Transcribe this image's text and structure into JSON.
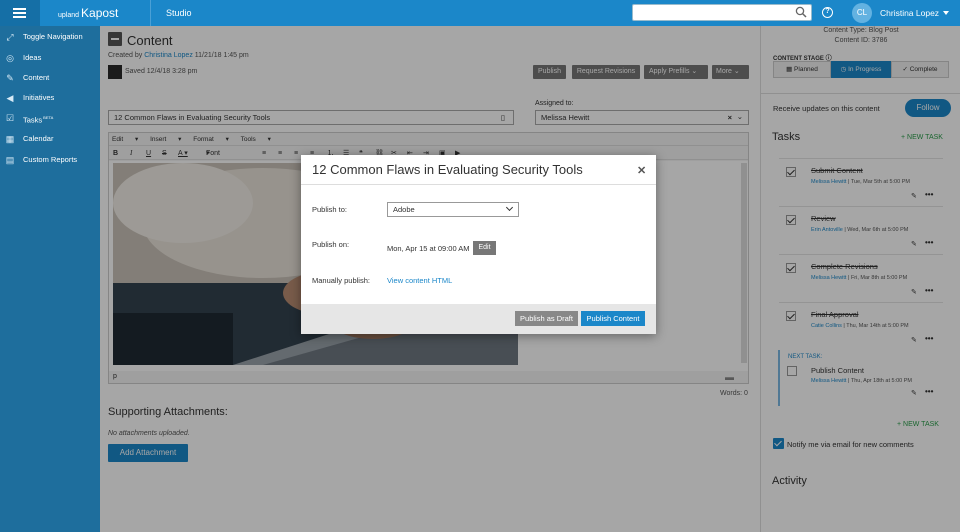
{
  "topbar": {
    "logo_prefix": "upland",
    "logo_name": "Kapost",
    "studio": "Studio",
    "search_placeholder": "",
    "user_initials": "CL",
    "user_name": "Christina Lopez"
  },
  "sidebar": {
    "items": [
      {
        "label": "Toggle Navigation",
        "icon": "expand-icon"
      },
      {
        "label": "Ideas",
        "icon": "lightbulb-icon"
      },
      {
        "label": "Content",
        "icon": "pencil-icon"
      },
      {
        "label": "Initiatives",
        "icon": "megaphone-icon"
      },
      {
        "label": "Tasks",
        "icon": "checklist-icon",
        "badge": "BETA"
      },
      {
        "label": "Calendar",
        "icon": "calendar-icon"
      },
      {
        "label": "Custom Reports",
        "icon": "report-icon"
      }
    ]
  },
  "main": {
    "title": "Content",
    "created_prefix": "Created by ",
    "created_by": "Christina Lopez",
    "created_date": " 11/21/18 1:45 pm",
    "saved": "Saved 12/4/18 3:28 pm",
    "buttons": {
      "publish": "Publish",
      "request_revisions": "Request Revisions",
      "apply_prefills": "Apply Prefills",
      "more": "More"
    },
    "content_title_value": "12 Common Flaws in Evaluating Security Tools",
    "assigned_label": "Assigned to:",
    "assigned_value": "Melissa Hewitt",
    "editor_menu": [
      "Edit",
      "Insert",
      "Format",
      "Tools"
    ],
    "font_sizes_label": "Font Sizes",
    "status_path": "p",
    "words": "Words: 0",
    "attachments_title": "Supporting Attachments:",
    "no_attachments": "No attachments uploaded.",
    "add_attachment": "Add Attachment"
  },
  "right": {
    "content_type": "Content Type: Blog Post",
    "content_id": "Content ID: 3786",
    "stage_label": "CONTENT STAGE",
    "stages": [
      "Planned",
      "In Progress",
      "Complete"
    ],
    "follow_text": "Receive updates on this content",
    "follow_btn": "Follow",
    "tasks_title": "Tasks",
    "new_task": "+ NEW TASK",
    "tasks": [
      {
        "name": "Submit Content",
        "assignee": "Melissa Hewitt",
        "date": " | Tue, Mar 5th at 5:00 PM"
      },
      {
        "name": "Review",
        "assignee": "Erin Antoville",
        "date": " | Wed, Mar 6th at 5:00 PM"
      },
      {
        "name": "Complete Revisions",
        "assignee": "Melissa Hewitt",
        "date": " | Fri, Mar 8th at 5:00 PM"
      },
      {
        "name": "Final Approval",
        "assignee": "Catie Collins",
        "date": " | Thu, Mar 14th at 5:00 PM"
      }
    ],
    "next_task_label": "NEXT TASK:",
    "next_task": {
      "name": "Publish Content",
      "assignee": "Melissa Hewitt",
      "date": " | Thu, Apr 18th at 5:00 PM"
    },
    "notify_text": "Notify me via email for new comments",
    "activity": "Activity"
  },
  "modal": {
    "title": "12 Common Flaws in Evaluating Security Tools",
    "publish_to_label": "Publish to:",
    "publish_to_value": "Adobe",
    "publish_on_label": "Publish on:",
    "publish_on_value": "Mon, Apr 15 at 09:00 AM",
    "edit": "Edit",
    "manual_label": "Manually publish:",
    "manual_link": "View content HTML",
    "draft_btn": "Publish as Draft",
    "publish_btn": "Publish Content"
  }
}
